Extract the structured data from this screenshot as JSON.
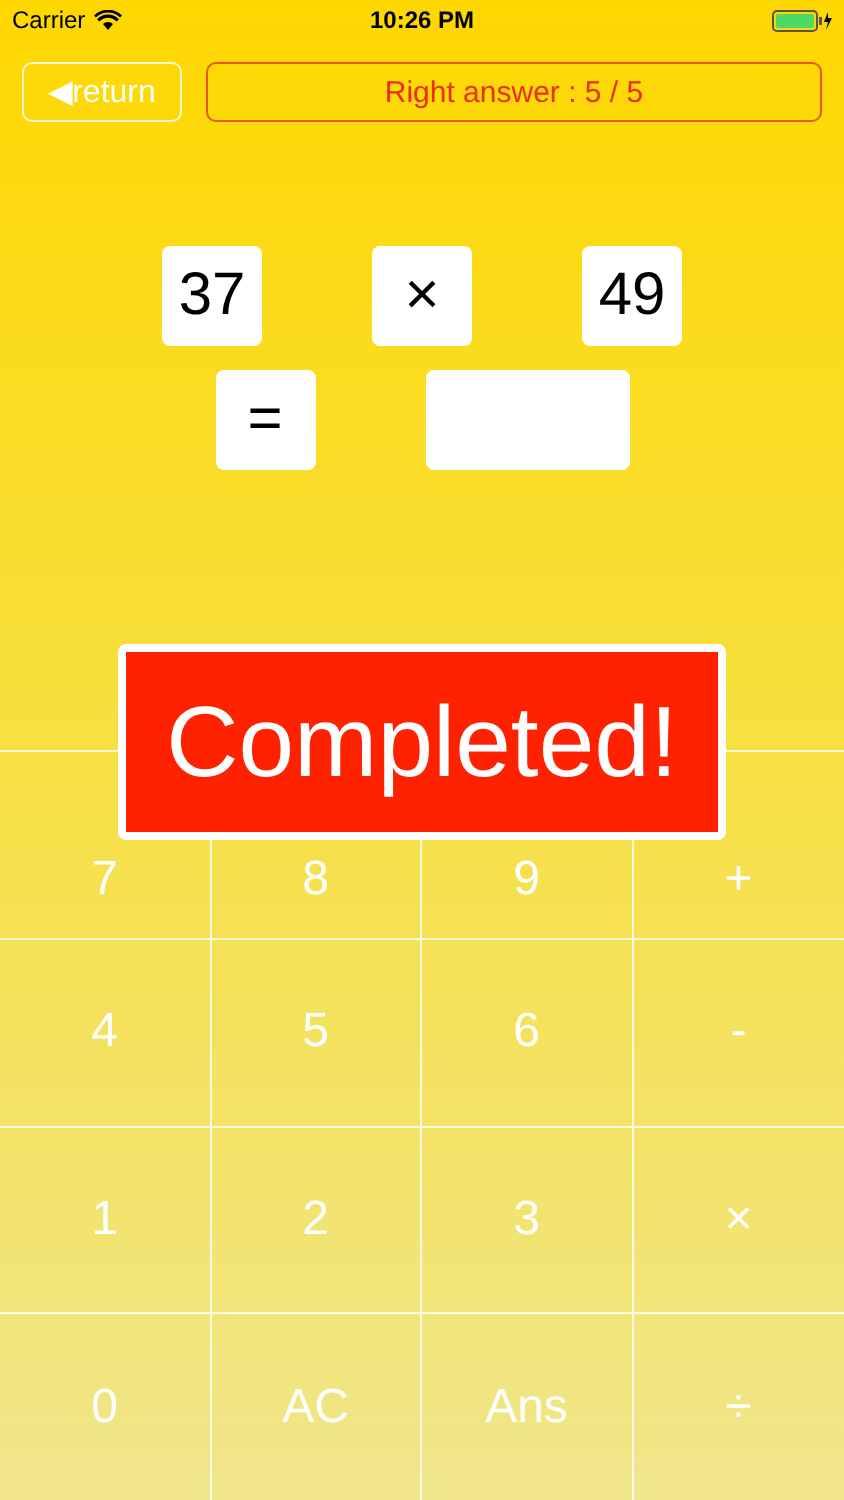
{
  "status_bar": {
    "carrier": "Carrier",
    "time": "10:26 PM"
  },
  "return_button": {
    "arrow": "◀",
    "label": "return"
  },
  "score": "Right answer : 5 / 5",
  "problem": {
    "operand_1": "37",
    "operator": "×",
    "operand_2": "49",
    "equals": "="
  },
  "banner": "Completed!",
  "keys": [
    "7",
    "8",
    "9",
    "+",
    "4",
    "5",
    "6",
    "-",
    "1",
    "2",
    "3",
    "×",
    "0",
    "AC",
    "Ans",
    "÷"
  ]
}
